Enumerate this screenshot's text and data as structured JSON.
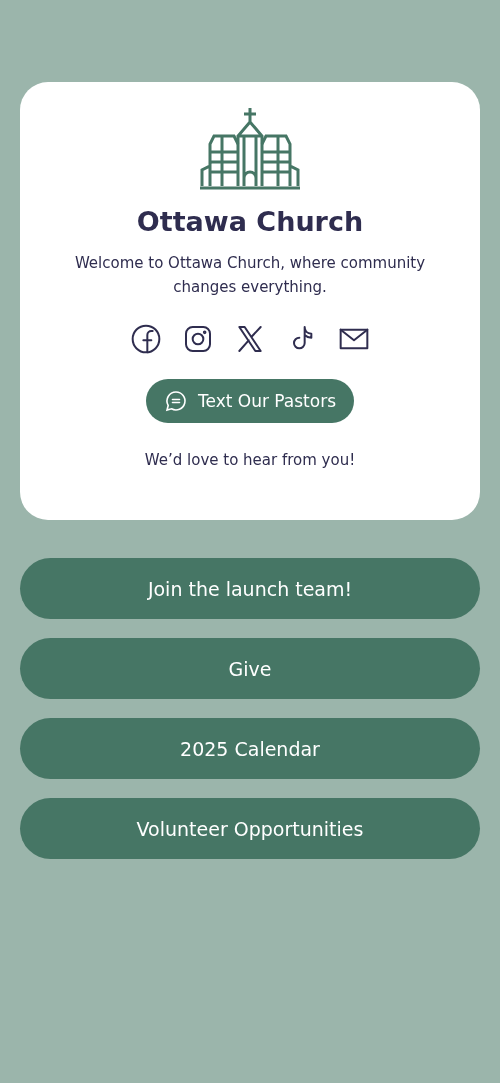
{
  "profile": {
    "name": "Ottawa Church",
    "bio": "Welcome to Ottawa Church, where community changes everything.",
    "contact_button": "Text Our Pastors",
    "note": "We’d love to hear from you!"
  },
  "links": [
    {
      "label": "Join the launch team!"
    },
    {
      "label": "Give"
    },
    {
      "label": "2025 Calendar"
    },
    {
      "label": "Volunteer Opportunities"
    }
  ]
}
